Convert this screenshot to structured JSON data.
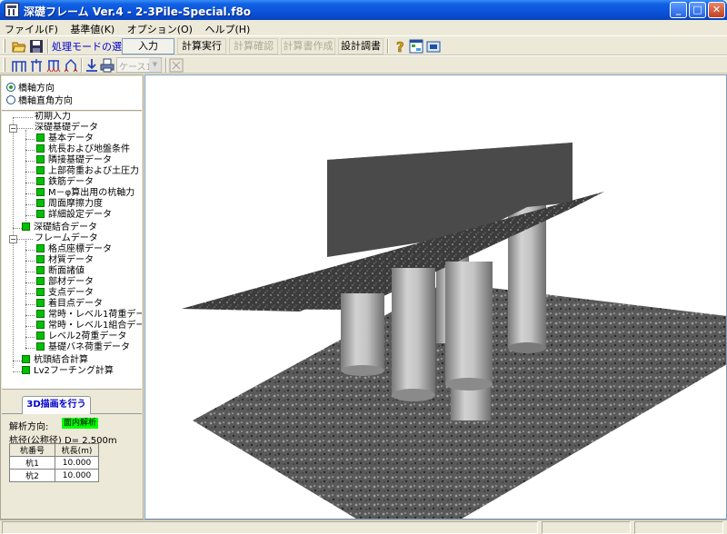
{
  "window": {
    "title": "深礎フレーム Ver.4 - 2-3Pile-Special.f8o",
    "controls": {
      "minimize": "_",
      "maximize": "□",
      "close": "✕"
    }
  },
  "menu": [
    "ファイル(F)",
    "基準値(K)",
    "オプション(O)",
    "ヘルプ(H)"
  ],
  "toolbar": {
    "mode_label": "処理モードの選択",
    "buttons": [
      {
        "label": "入力",
        "state": "active"
      },
      {
        "label": "計算実行",
        "state": "normal"
      },
      {
        "label": "計算確認",
        "state": "disabled"
      },
      {
        "label": "計算書作成",
        "state": "disabled"
      },
      {
        "label": "設計調書",
        "state": "normal"
      }
    ],
    "case_select": "ケース1"
  },
  "direction": {
    "options": [
      "橋軸方向",
      "橋軸直角方向"
    ],
    "selected": "橋軸方向"
  },
  "tree": {
    "initial": "初期入力",
    "foundation": {
      "label": "深礎基礎データ",
      "items": [
        "基本データ",
        "杭長および地盤条件",
        "隣接基礎データ",
        "上部荷重および土圧力",
        "鉄筋データ",
        "M－φ算出用の杭軸力",
        "周面摩擦力度",
        "詳細設定データ"
      ]
    },
    "combined": "深礎結合データ",
    "frame": {
      "label": "フレームデータ",
      "items": [
        "格点座標データ",
        "材質データ",
        "断面諸値",
        "部材データ",
        "支点データ",
        "着目点データ",
        "常時・レベル1荷重データ",
        "常時・レベル1組合データ",
        "レベル2荷重データ",
        "基礎バネ荷重データ"
      ]
    },
    "pile_head": "杭頭結合計算",
    "footing": "Lv2フーチング計算"
  },
  "info": {
    "draw3d": "3D描画を行う",
    "analysis_label": "解析方向:",
    "analysis_value": "面内解析",
    "pile_diameter": "杭径(公称径) D= 2.500m",
    "table_headers": [
      "杭番号",
      "杭長(m)"
    ],
    "table_rows": [
      [
        "杭1",
        "10.000"
      ],
      [
        "杭2",
        "10.000"
      ]
    ]
  },
  "colors": {
    "titlebar": "#0a4fd6",
    "mode_label": "#0000c8",
    "tree_node": "#00c000",
    "analysis_highlight": "#00ff00",
    "footing_top": "#5e5e5e",
    "footing_side": "#4a4a4a",
    "ground_plane": "#3c3c3c",
    "pile": "#b4b4b4"
  },
  "icons": [
    "open-folder-icon",
    "save-icon",
    "help-icon",
    "view-icon",
    "export-icon",
    "frame-icon",
    "pile-icon",
    "support-icon",
    "load-icon",
    "down-arrow-icon",
    "print-icon",
    "fit-view-icon"
  ]
}
